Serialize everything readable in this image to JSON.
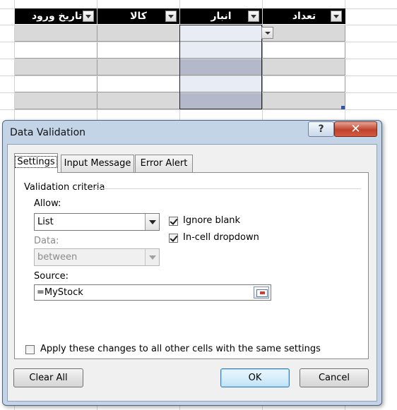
{
  "sheet": {
    "headers": [
      "تعداد",
      "انبار",
      "کالا",
      "تاریخ ورود"
    ]
  },
  "dialog": {
    "title": "Data Validation",
    "help_glyph": "?",
    "close_glyph": "✕",
    "tabs": [
      {
        "label": "Settings",
        "active": true
      },
      {
        "label": "Input Message",
        "active": false
      },
      {
        "label": "Error Alert",
        "active": false
      }
    ],
    "criteria_heading": "Validation criteria",
    "allow": {
      "label": "Allow:",
      "value": "List"
    },
    "data": {
      "label": "Data:",
      "value": "between",
      "disabled": true
    },
    "source": {
      "label": "Source:",
      "value": "=MyStock"
    },
    "ignore_blank": {
      "label": "Ignore blank",
      "checked": true
    },
    "in_cell_dropdown": {
      "label": "In-cell dropdown",
      "checked": true
    },
    "apply_all": {
      "label": "Apply these changes to all other cells with the same settings",
      "checked": false
    },
    "buttons": {
      "clear_all": "Clear All",
      "ok": "OK",
      "cancel": "Cancel"
    }
  },
  "colors": {
    "header_bg": "#000000",
    "band_gray": "#d9d9d9",
    "selected_light": "#e8ecf5",
    "selected_dark": "#b4b9c9",
    "dialog_frame": "#c3d4e7",
    "close_red": "#c0432c"
  }
}
